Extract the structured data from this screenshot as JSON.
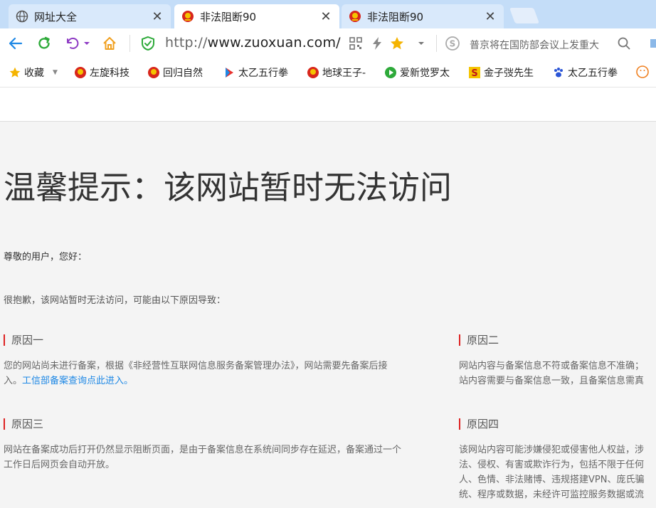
{
  "tabs": [
    {
      "label": "网址大全",
      "icon": "globe-icon",
      "active": false
    },
    {
      "label": "非法阻断90",
      "icon": "emblem-icon",
      "active": true
    },
    {
      "label": "非法阻断90",
      "icon": "emblem-icon",
      "active": false
    }
  ],
  "toolbar": {
    "url_protocol": "http://",
    "url_host": "www.zuoxuan.com/",
    "search_placeholder": "普京将在国防部会议上发重大"
  },
  "bookmarks": [
    {
      "label": "收藏",
      "icon": "star-icon"
    },
    {
      "label": "左旋科技",
      "icon": "emblem-icon"
    },
    {
      "label": "回归自然",
      "icon": "emblem-icon"
    },
    {
      "label": "太乙五行拳",
      "icon": "youku-icon"
    },
    {
      "label": "地球王子-",
      "icon": "emblem-icon"
    },
    {
      "label": "爱新觉罗太",
      "icon": "play-icon"
    },
    {
      "label": "金子弢先生",
      "icon": "s-logo-icon"
    },
    {
      "label": "太乙五行拳",
      "icon": "paw-icon"
    }
  ],
  "page": {
    "title": "温馨提示：该网站暂时无法访问",
    "greeting": "尊敬的用户，您好：",
    "sorry": "很抱歉，该网站暂时无法访问，可能由以下原因导致：",
    "reasons": [
      {
        "title": "原因一",
        "body_line1": "您的网站尚未进行备案，根据《非经营性互联网信息服务备案管理办法》，网站需要先备案后接",
        "body_line2_prefix": "入。",
        "link": "工信部备案查询点此进入。"
      },
      {
        "title": "原因二",
        "body_line1": "网站内容与备案信息不符或备案信息不准确；",
        "body_line2": "站内容需要与备案信息一致，且备案信息需真"
      },
      {
        "title": "原因三",
        "body_line1": "网站在备案成功后打开仍然显示阻断页面，是由于备案信息在系统间同步存在延迟，备案通过一个",
        "body_line2": "工作日后网页会自动开放。"
      },
      {
        "title": "原因四",
        "body_line1": "该网站内容可能涉嫌侵犯或侵害他人权益，涉",
        "body_line2": "法、侵权、有害或欺诈行为，包括不限于任何",
        "body_line3": "人、色情、非法赌博、违规搭建VPN、庞氏骗",
        "body_line4": "统、程序或数据，未经许可监控服务数据或流"
      }
    ]
  }
}
